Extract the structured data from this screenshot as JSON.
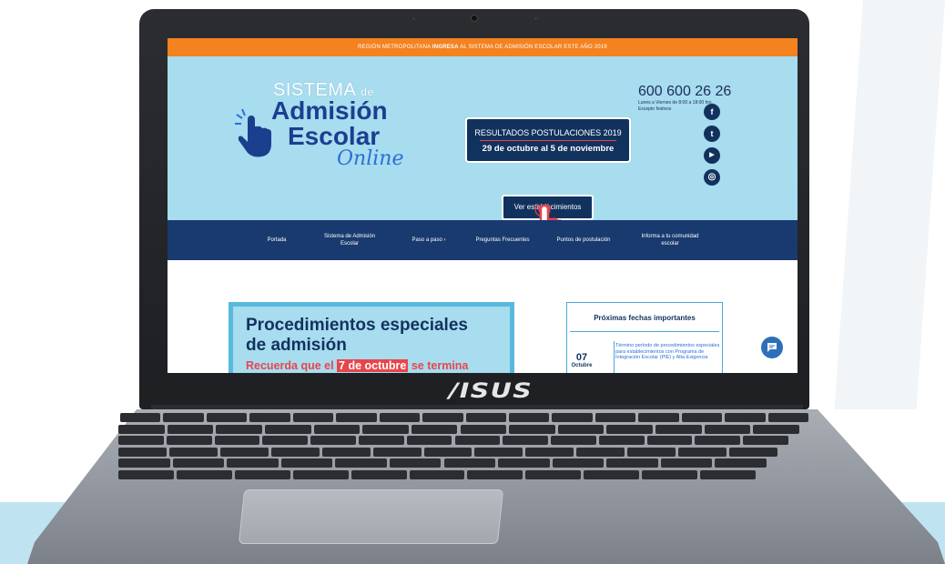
{
  "topbar": {
    "text_pre": "REGIÓN METROPOLITANA ",
    "text_bold": "INGRESA",
    "text_post": " AL SISTEMA DE ADMISIÓN ESCOLAR ESTE AÑO 2019"
  },
  "logo": {
    "line1": "SISTEMA",
    "line1_small": "de",
    "line2": "Admisión",
    "line3": "Escolar",
    "line4": "Online"
  },
  "contact": {
    "phone": "600 600 26 26",
    "hours_line1": "Lunes a Viernes de 8:00 a 18:00 hrs.",
    "hours_line2": "Excepto festivos"
  },
  "results_box": {
    "title": "RESULTADOS POSTULACIONES 2019",
    "dates": "29 de octubre al 5 de noviembre"
  },
  "cta": {
    "label": "Ver establecimientos"
  },
  "social": {
    "facebook": "f",
    "twitter": "t",
    "youtube": "▶",
    "instagram": "◎"
  },
  "nav": {
    "items": [
      {
        "label": "Portada"
      },
      {
        "label": "Sistema de Admisión Escolar"
      },
      {
        "label": "Paso a paso"
      },
      {
        "label": "Preguntas Frecuentes"
      },
      {
        "label": "Puntos de postulación"
      },
      {
        "label": "Informa a tu comunidad escolar"
      }
    ],
    "dropdown_marker": "›"
  },
  "banner": {
    "title": "Procedimientos especiales de admisión",
    "text_pre": "Recuerda que el ",
    "text_hl": "7 de octubre",
    "text_post": " se termina"
  },
  "dates_panel": {
    "title": "Próximas fechas importantes",
    "day": "07",
    "month": "Octubre",
    "description": "Término período de procedimientos especiales para establecimientos con Programa de Integración Escolar (PIE) y Alta Exigencia"
  },
  "chat": {
    "icon": "chat-icon"
  },
  "laptop": {
    "brand": "/ISUS"
  },
  "colors": {
    "orange": "#f4821f",
    "navy": "#12325e",
    "sky": "#a8dcef",
    "red": "#e8454b"
  }
}
